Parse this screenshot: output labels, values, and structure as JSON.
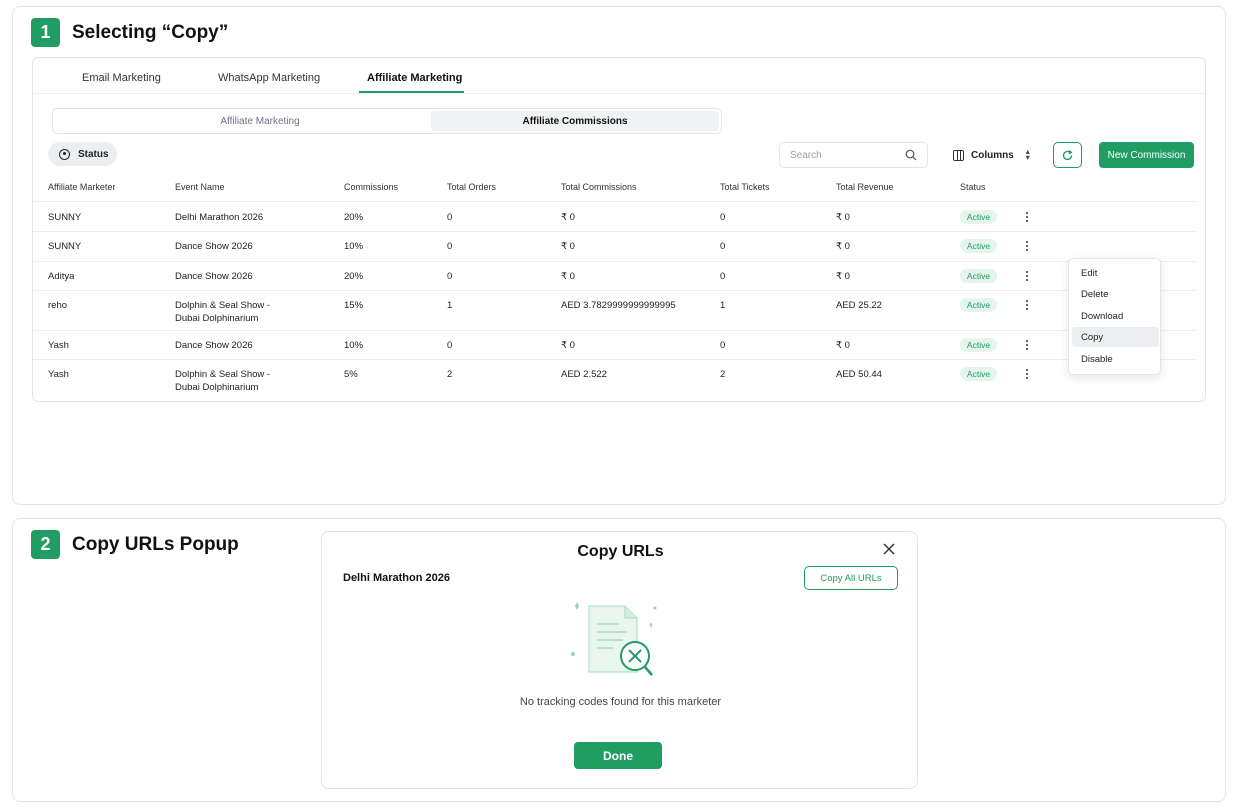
{
  "step1": {
    "number": "1",
    "title": "Selecting “Copy”"
  },
  "tabs": [
    {
      "label": "Email Marketing"
    },
    {
      "label": "WhatsApp Marketing"
    },
    {
      "label": "Affiliate Marketing",
      "active": true
    }
  ],
  "segments": [
    {
      "label": "Affiliate Marketing"
    },
    {
      "label": "Affiliate Commissions",
      "active": true
    }
  ],
  "toolbar": {
    "status_label": "Status",
    "search_placeholder": "Search",
    "columns_label": "Columns",
    "new_label": "New Commission"
  },
  "table": {
    "headers": [
      "Affiliate Marketer",
      "Event Name",
      "Commissions",
      "Total Orders",
      "Total Commissions",
      "Total Tickets",
      "Total Revenue",
      "Status"
    ],
    "rows": [
      {
        "marketer": "SUNNY",
        "event": "Delhi Marathon 2026",
        "event2": "",
        "commission": "20%",
        "orders": "0",
        "total_commissions": "₹ 0",
        "tickets": "0",
        "revenue": "₹ 0",
        "status": "Active"
      },
      {
        "marketer": "SUNNY",
        "event": "Dance Show 2026",
        "event2": "",
        "commission": "10%",
        "orders": "0",
        "total_commissions": "₹ 0",
        "tickets": "0",
        "revenue": "₹ 0",
        "status": "Active"
      },
      {
        "marketer": "Aditya",
        "event": "Dance Show 2026",
        "event2": "",
        "commission": "20%",
        "orders": "0",
        "total_commissions": "₹ 0",
        "tickets": "0",
        "revenue": "₹ 0",
        "status": "Active"
      },
      {
        "marketer": "reho",
        "event": "Dolphin & Seal Show -",
        "event2": "Dubai Dolphinarium",
        "commission": "15%",
        "orders": "1",
        "total_commissions": "AED 3.7829999999999995",
        "tickets": "1",
        "revenue": "AED 25.22",
        "status": "Active"
      },
      {
        "marketer": "Yash",
        "event": "Dance Show 2026",
        "event2": "",
        "commission": "10%",
        "orders": "0",
        "total_commissions": "₹ 0",
        "tickets": "0",
        "revenue": "₹ 0",
        "status": "Active"
      },
      {
        "marketer": "Yash",
        "event": "Dolphin & Seal Show -",
        "event2": "Dubai Dolphinarium",
        "commission": "5%",
        "orders": "2",
        "total_commissions": "AED 2.522",
        "tickets": "2",
        "revenue": "AED 50.44",
        "status": "Active"
      }
    ]
  },
  "context_menu": {
    "items": [
      {
        "label": "Edit"
      },
      {
        "label": "Delete"
      },
      {
        "label": "Download"
      },
      {
        "label": "Copy",
        "active": true
      },
      {
        "label": "Disable"
      }
    ]
  },
  "step2": {
    "number": "2",
    "title": "Copy URLs Popup"
  },
  "modal": {
    "title": "Copy URLs",
    "event_name": "Delhi Marathon 2026",
    "copy_all_label": "Copy All URLs",
    "empty_text": "No tracking codes found for this marketer",
    "done_label": "Done"
  },
  "colors": {
    "accent": "#1f9d62",
    "badge_bg": "#e3f5ec",
    "border": "#e3e5e8"
  }
}
